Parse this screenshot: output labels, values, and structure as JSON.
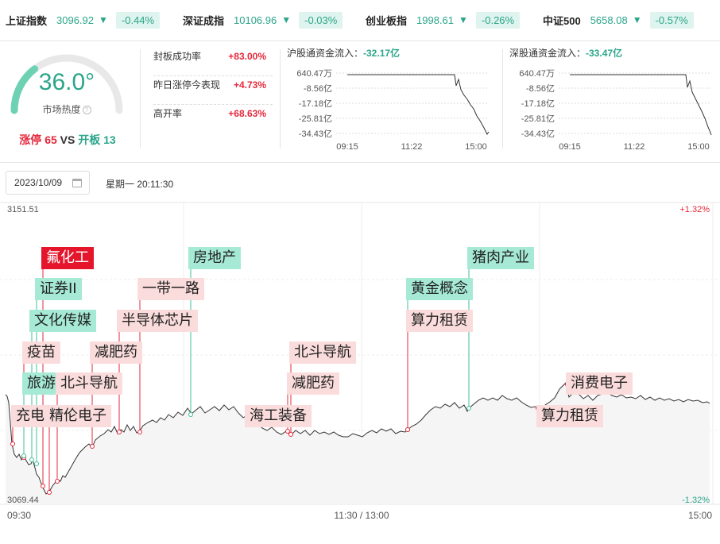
{
  "indices": [
    {
      "name": "上证指数",
      "value": "3096.92",
      "arrow": "▼",
      "pct": "-0.44%"
    },
    {
      "name": "深证成指",
      "value": "10106.96",
      "arrow": "▼",
      "pct": "-0.03%"
    },
    {
      "name": "创业板指",
      "value": "1998.61",
      "arrow": "▼",
      "pct": "-0.26%"
    },
    {
      "name": "中证500",
      "value": "5658.08",
      "arrow": "▼",
      "pct": "-0.57%"
    }
  ],
  "heat": {
    "value": "36.0°",
    "label": "市场热度",
    "help": "?",
    "level": 0.36,
    "limit_up_label": "涨停",
    "limit_up": "65",
    "vs": "VS",
    "open_label": "开板",
    "open": "13"
  },
  "stats": [
    {
      "label": "封板成功率",
      "value": "+83.00%"
    },
    {
      "label": "昨日涨停今表现",
      "value": "+4.73%"
    },
    {
      "label": "高开率",
      "value": "+68.63%"
    }
  ],
  "flows": [
    {
      "title": "沪股通资金流入：",
      "value": "-32.17亿",
      "y_ticks": [
        "640.47万",
        "-8.56亿",
        "-17.18亿",
        "-25.81亿",
        "-34.43亿"
      ],
      "x_ticks": [
        "09:15",
        "11:22",
        "15:00"
      ]
    },
    {
      "title": "深股通资金流入：",
      "value": "-33.47亿",
      "y_ticks": [
        "640.47万",
        "-8.56亿",
        "-17.18亿",
        "-25.81亿",
        "-34.43亿"
      ],
      "x_ticks": [
        "09:15",
        "11:22",
        "15:00"
      ]
    }
  ],
  "date": "2023/10/09",
  "weekday_time": "星期一 20:11:30",
  "chart_data": {
    "type": "line",
    "y_top_label": "3151.51",
    "y_bottom_label": "3069.44",
    "right_top_label": "+1.32%",
    "right_bottom_label": "-1.32%",
    "x_ticks": [
      "09:30",
      "11:30 / 13:00",
      "15:00"
    ],
    "concept_tags": [
      {
        "text": "氟化工",
        "style": "hot"
      },
      {
        "text": "证券II",
        "style": "mint"
      },
      {
        "text": "文化传媒",
        "style": "mint"
      },
      {
        "text": "疫苗",
        "style": "pink"
      },
      {
        "text": "旅游",
        "style": "mint"
      },
      {
        "text": "充电",
        "style": "pink"
      },
      {
        "text": "精伦电子",
        "style": "pink"
      },
      {
        "text": "北斗导航",
        "style": "pink"
      },
      {
        "text": "减肥药",
        "style": "pink"
      },
      {
        "text": "半导体芯片",
        "style": "pink"
      },
      {
        "text": "一带一路",
        "style": "pink"
      },
      {
        "text": "房地产",
        "style": "mint"
      },
      {
        "text": "海工装备",
        "style": "pink"
      },
      {
        "text": "北斗导航",
        "style": "pink"
      },
      {
        "text": "减肥药",
        "style": "pink"
      },
      {
        "text": "黄金概念",
        "style": "mint"
      },
      {
        "text": "算力租赁",
        "style": "pink"
      },
      {
        "text": "猪肉产业",
        "style": "mint"
      },
      {
        "text": "消费电子",
        "style": "pink"
      },
      {
        "text": "算力租赁",
        "style": "pink"
      }
    ]
  },
  "colors": {
    "up": "#e5283c",
    "down": "#2aa58a",
    "mint": "#a6ead6",
    "pink": "#fbdcdc"
  }
}
